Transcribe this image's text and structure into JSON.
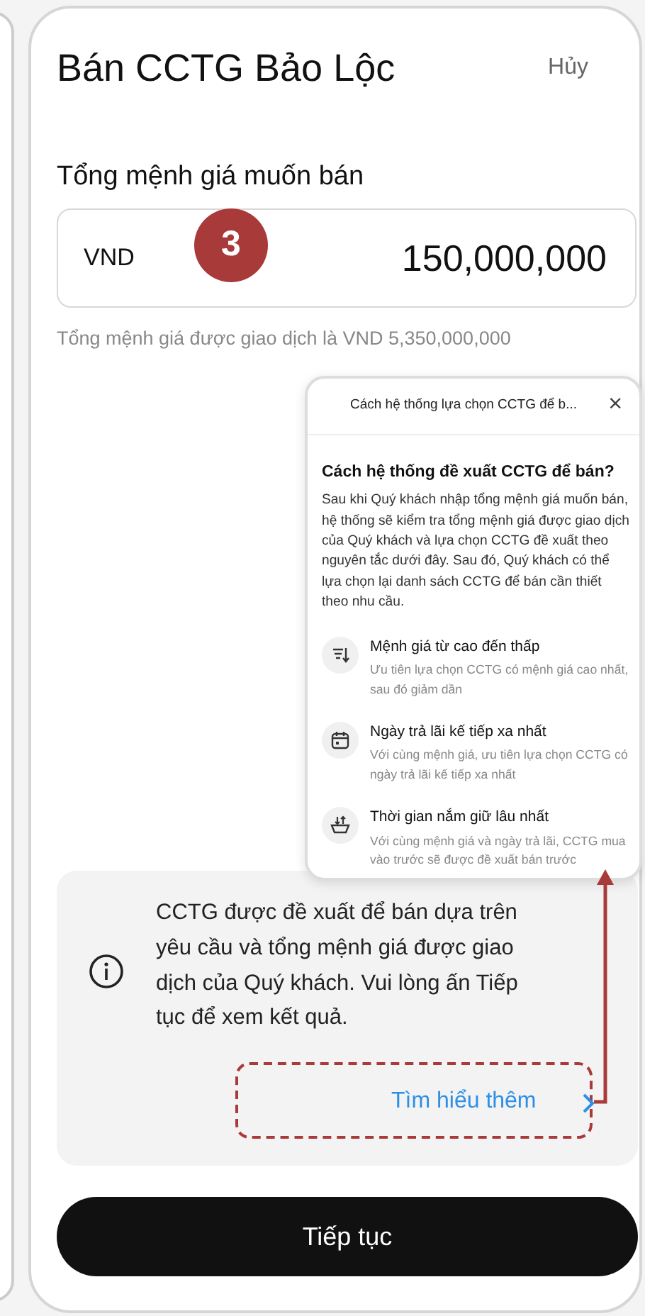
{
  "header": {
    "title": "Bán CCTG Bảo Lộc",
    "cancel": "Hủy"
  },
  "amount": {
    "label": "Tổng mệnh giá muốn bán",
    "currency": "VND",
    "value": "150,000,000",
    "hint": "Tổng mệnh giá được giao dịch là VND 5,350,000,000"
  },
  "step_badge": "3",
  "popup": {
    "title": "Cách hệ thống lựa chọn CCTG để b...",
    "close": "×",
    "heading": "Cách hệ thống đề xuất CCTG để bán?",
    "body": "Sau khi Quý khách nhập tổng mệnh giá muốn bán, hệ thống sẽ kiểm tra tổng mệnh giá được giao dịch của Quý khách và lựa chọn CCTG đề xuất theo nguyên tắc dưới đây. Sau đó, Quý khách có thể lựa chọn lại danh sách CCTG để bán cần thiết theo nhu cầu.",
    "rules": [
      {
        "kind": "sort",
        "title": "Mệnh giá từ cao đến thấp",
        "desc": "Ưu tiên lựa chọn CCTG có mệnh giá cao nhất, sau đó giảm dần"
      },
      {
        "kind": "calendar",
        "title": "Ngày trả lãi kế tiếp xa nhất",
        "desc": "Với cùng mệnh giá, ưu tiên lựa chọn CCTG có ngày trả lãi kế tiếp xa nhất"
      },
      {
        "kind": "basket",
        "title": "Thời gian nắm giữ lâu nhất",
        "desc": "Với cùng mệnh giá và ngày trả lãi, CCTG mua vào trước sẽ được đề xuất bán trước"
      }
    ]
  },
  "info": {
    "text": "CCTG được đề xuất để bán dựa trên yêu cầu và tổng mệnh giá được giao dịch của Quý khách. Vui lòng ấn Tiếp tục để xem kết quả.",
    "link": "Tìm hiểu thêm"
  },
  "continue_button": "Tiếp tục"
}
